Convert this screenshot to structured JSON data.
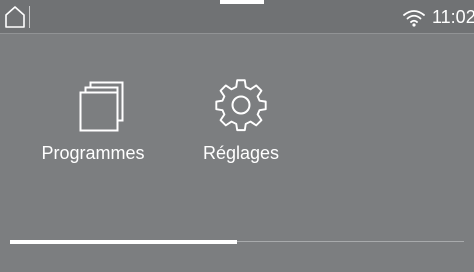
{
  "status_bar": {
    "home_icon": "home-icon",
    "wifi_icon": "wifi-icon",
    "time": "11:02"
  },
  "menu": {
    "tiles": [
      {
        "label": "Programmes",
        "icon": "programmes-icon"
      },
      {
        "label": "Réglages",
        "icon": "gear-icon"
      }
    ]
  },
  "page_indicator": {
    "current_page": 1,
    "total_pages": 2
  },
  "colors": {
    "background": "#7c7e80",
    "foreground": "#ffffff"
  }
}
